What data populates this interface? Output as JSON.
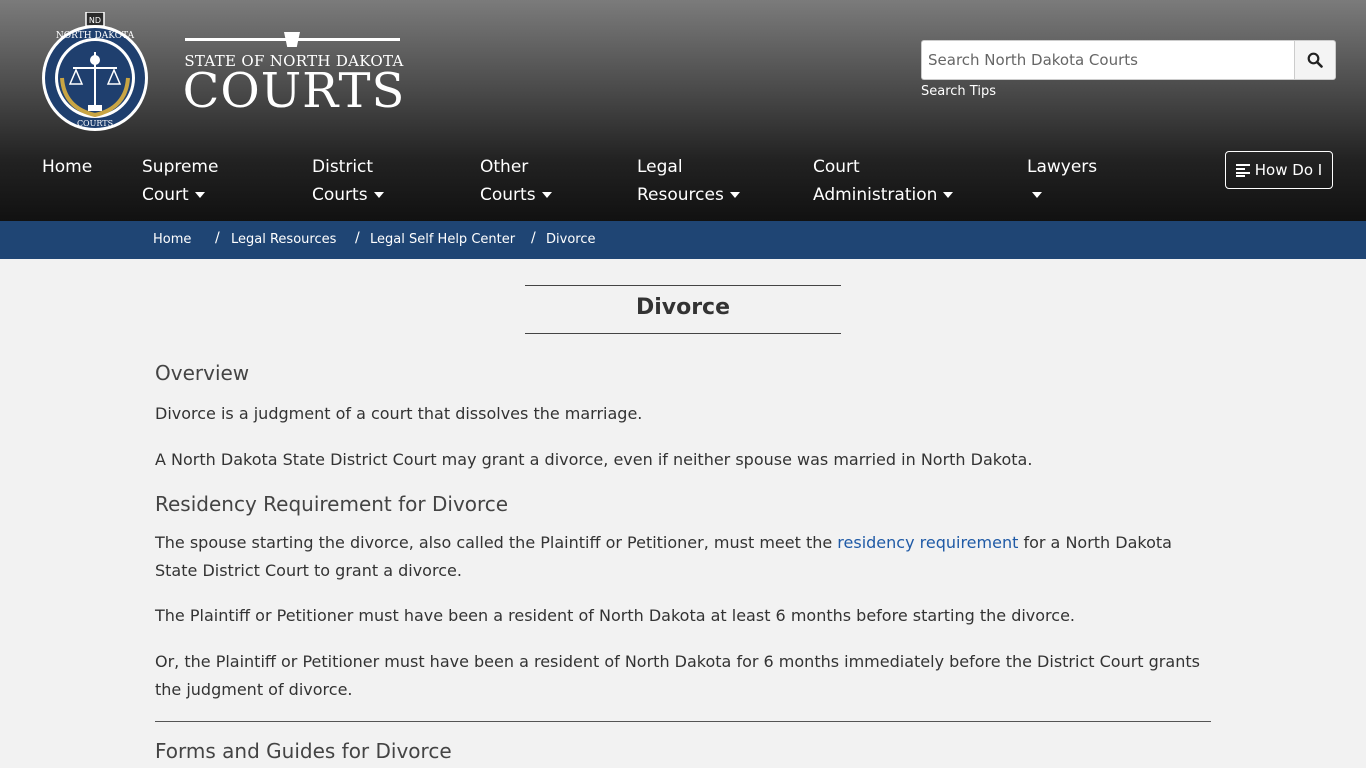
{
  "brand": {
    "seal_ring_text": "NORTH DAKOTA",
    "seal_bottom_text": "COURTS",
    "seal_badge": "ND",
    "wordmark_top": "STATE OF NORTH DAKOTA",
    "wordmark_main": "COURTS"
  },
  "search": {
    "placeholder": "Search North Dakota Courts",
    "tips_label": "Search Tips"
  },
  "nav": {
    "home": "Home",
    "supreme_1": "Supreme",
    "supreme_2": "Court",
    "district_1": "District",
    "district_2": "Courts",
    "other_1": "Other",
    "other_2": "Courts",
    "legal_1": "Legal",
    "legal_2": "Resources",
    "admin_1": "Court",
    "admin_2": "Administration",
    "lawyers": "Lawyers",
    "how_do_i": "How Do I"
  },
  "breadcrumb": [
    "Home",
    "Legal Resources",
    "Legal Self Help Center",
    "Divorce"
  ],
  "page": {
    "title": "Divorce",
    "overview_heading": "Overview",
    "overview_p1": "Divorce is a judgment of a court that dissolves the marriage.",
    "overview_p2": "A North Dakota State District Court may grant a divorce, even if neither spouse was married in North Dakota.",
    "residency_heading": "Residency Requirement for Divorce",
    "residency_p1_before": "The spouse starting the divorce, also called the Plaintiff or Petitioner, must meet the ",
    "residency_p1_link": "residency requirement",
    "residency_p1_after": " for a North Dakota State District Court to grant a divorce.",
    "residency_p2": "The Plaintiff or Petitioner must have been a resident of North Dakota at least 6 months before starting the divorce.",
    "residency_p3": "Or, the Plaintiff or Petitioner must have been a resident of North Dakota for 6 months immediately before the District Court grants the judgment of divorce.",
    "forms_heading": "Forms and Guides for Divorce"
  },
  "colors": {
    "breadcrumb_bg": "#1f4574",
    "link": "#1f5aa6",
    "seal_blue": "#1f3f6e"
  }
}
